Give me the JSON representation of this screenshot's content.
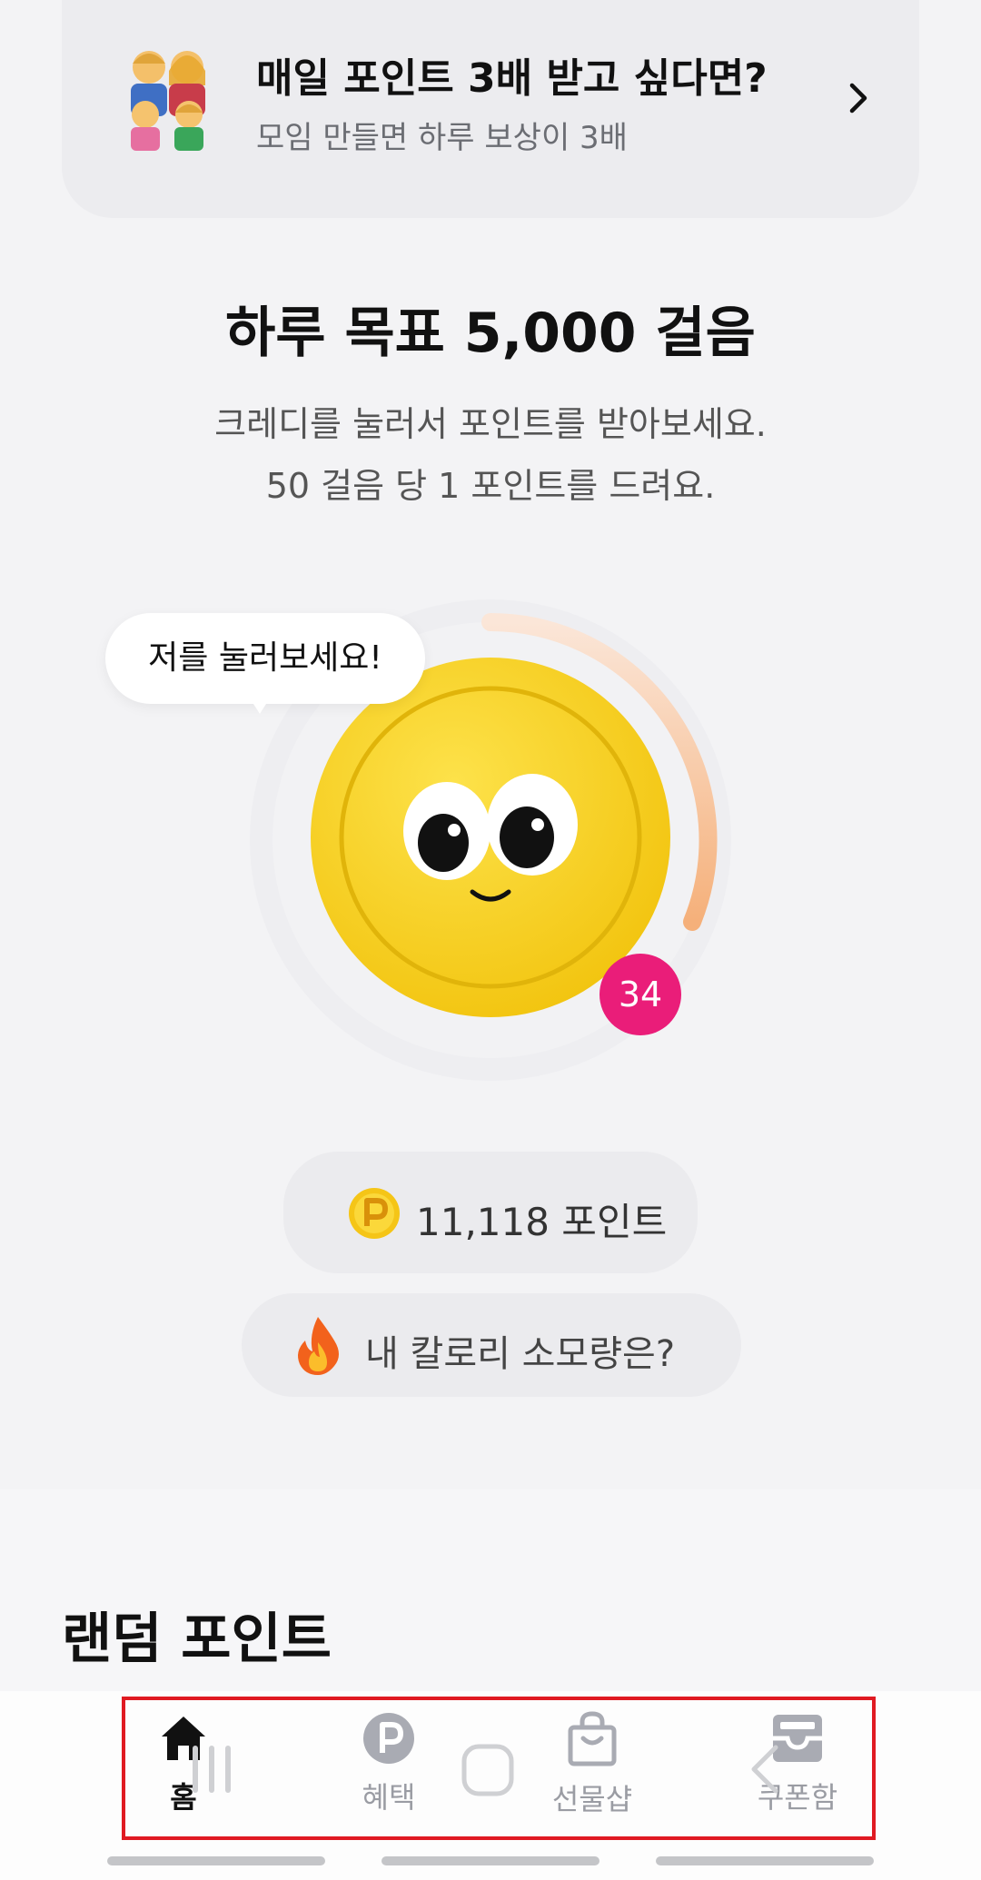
{
  "banner": {
    "title": "매일 포인트 3배 받고 싶다면?",
    "subtitle": "모임 만들면 하루 보상이 3배",
    "emoji_icon": "family-emoji-icon",
    "chevron_icon": "chevron-right-icon"
  },
  "goal": {
    "title": "하루 목표 5,000 걸음",
    "line1": "크레디를 눌러서 포인트를 받아보세요.",
    "line2": "50 걸음 당 1 포인트를 드려요."
  },
  "coin": {
    "bubble": "저를 눌러보세요!",
    "badge": "34",
    "accent_color": "#ea1d79",
    "coin_color": "#f7d21a"
  },
  "points": {
    "icon": "p-coin-icon",
    "label": "11,118 포인트"
  },
  "calorie": {
    "icon": "fire-icon",
    "label": "내 칼로리 소모량은?"
  },
  "section": {
    "title": "랜덤 포인트"
  },
  "tabbar": {
    "tabs": [
      {
        "label": "홈",
        "icon": "home-icon",
        "active": true
      },
      {
        "label": "혜택",
        "icon": "benefit-p-icon",
        "active": false
      },
      {
        "label": "선물샵",
        "icon": "shopping-bag-icon",
        "active": false
      },
      {
        "label": "쿠폰함",
        "icon": "inbox-icon",
        "active": false
      }
    ],
    "highlight_color": "#e01a22"
  }
}
